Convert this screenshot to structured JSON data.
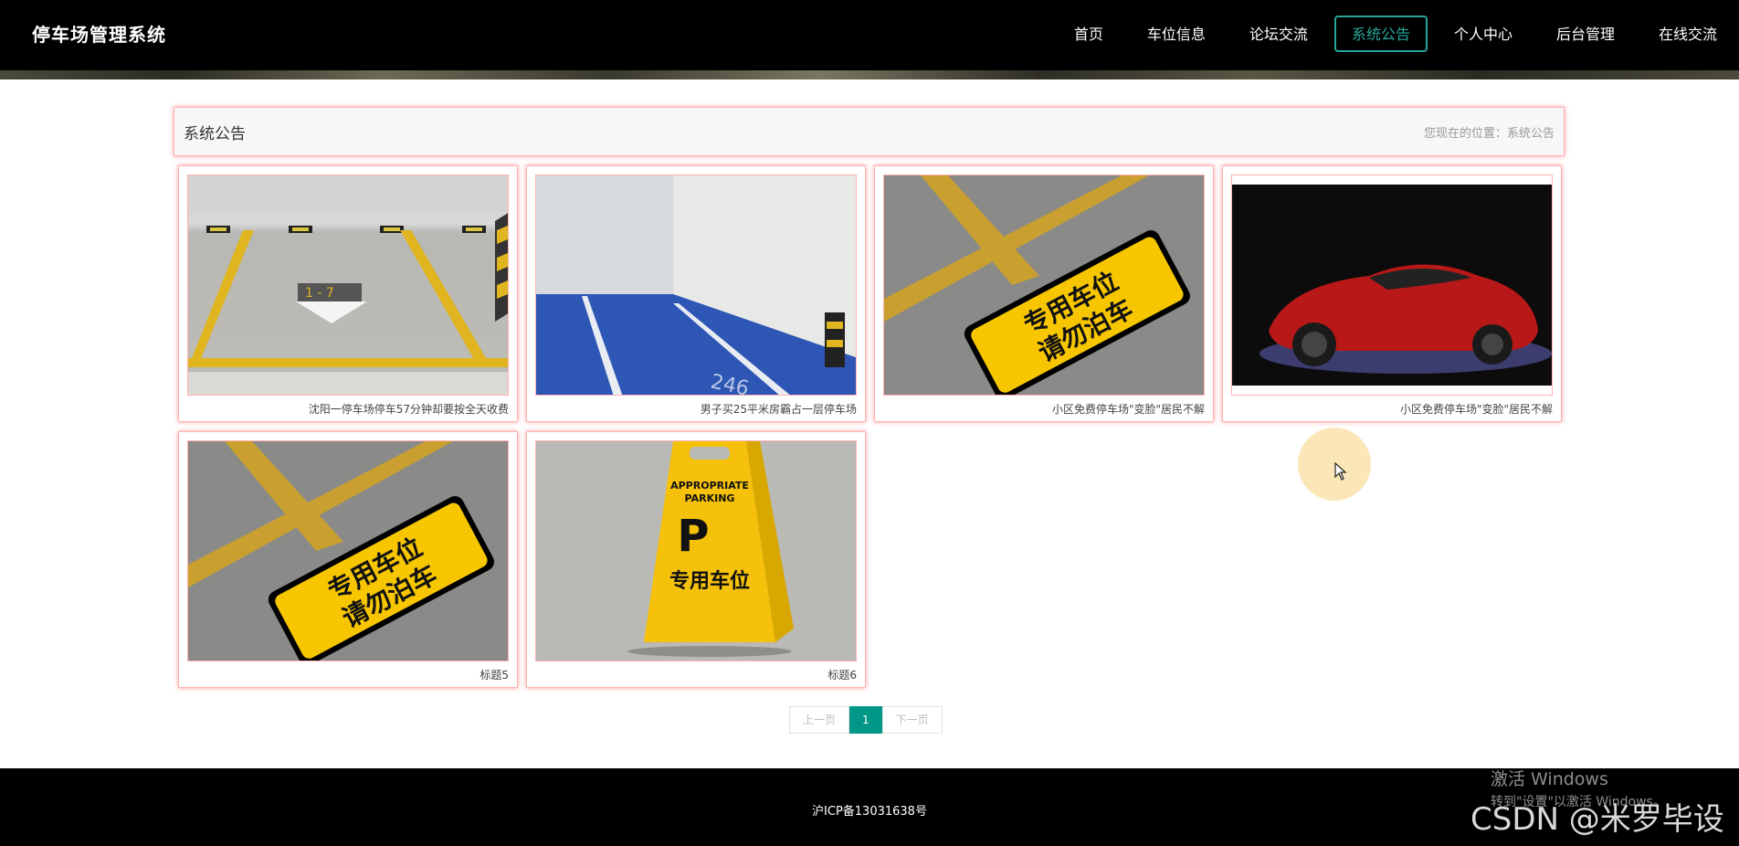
{
  "header": {
    "brand": "停车场管理系统",
    "nav": [
      {
        "label": "首页"
      },
      {
        "label": "车位信息"
      },
      {
        "label": "论坛交流"
      },
      {
        "label": "系统公告",
        "active": true
      },
      {
        "label": "个人中心"
      },
      {
        "label": "后台管理"
      },
      {
        "label": "在线交流"
      }
    ]
  },
  "page": {
    "title": "系统公告",
    "breadcrumb": "您现在的位置：系统公告"
  },
  "cards": [
    {
      "caption": "沈阳一停车场停车57分钟却要按全天收费",
      "image": "parking-garage-photo"
    },
    {
      "caption": "男子买25平米房霸占一层停车场",
      "image": "blue-parking-lot-photo"
    },
    {
      "caption": "小区免费停车场\"变脸\"居民不解",
      "image": "reserved-parking-floor-sign-photo",
      "sign_text": "专用车位 请勿泊车"
    },
    {
      "caption": "小区免费停车场\"变脸\"居民不解",
      "image": "red-sports-car-photo"
    },
    {
      "caption": "标题5",
      "image": "reserved-parking-floor-sign-photo",
      "sign_text": "专用车位 请勿泊车"
    },
    {
      "caption": "标题6",
      "image": "parking-a-frame-sign-photo",
      "sign_text": "APPROPRIATE PARKING P 专用车位"
    }
  ],
  "pagination": {
    "prev": "上一页",
    "current": "1",
    "next": "下一页"
  },
  "footer": {
    "icp": "沪ICP备13031638号"
  },
  "overlays": {
    "windows_activation": "激活 Windows",
    "windows_activation_sub": "转到\"设置\"以激活 Windows。",
    "watermark": "CSDN @米罗毕设"
  },
  "colors": {
    "accent": "#26a69a",
    "pager_active": "#009688",
    "card_border": "#ffb1b1"
  }
}
